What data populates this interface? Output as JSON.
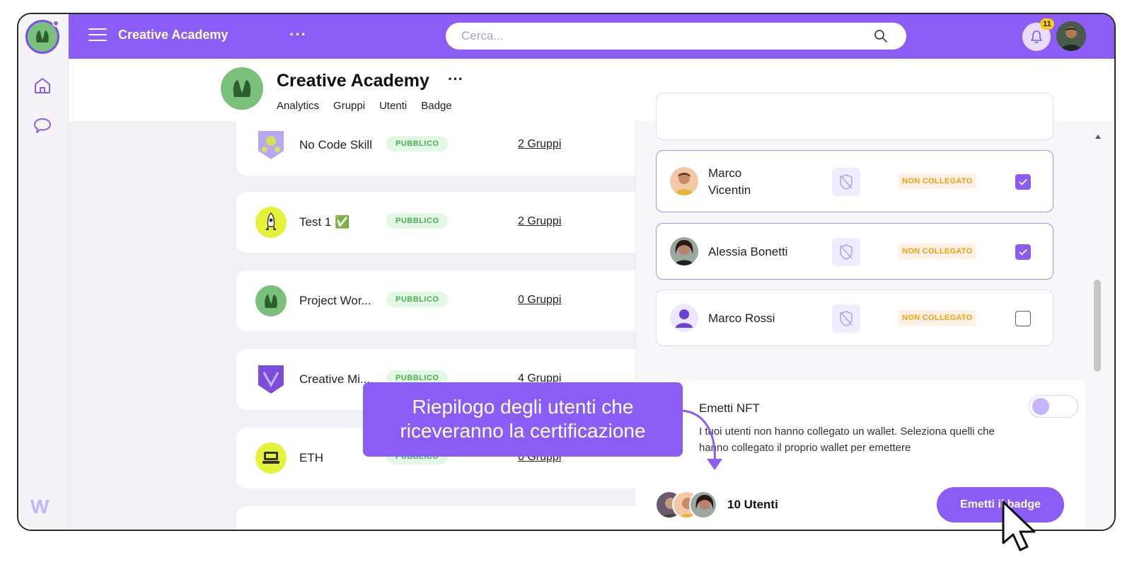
{
  "topbar": {
    "app_title": "Creative Academy",
    "search_placeholder": "Cerca...",
    "notifications_count": "11"
  },
  "header": {
    "org_name": "Creative Academy",
    "tabs": [
      {
        "label": "Analytics",
        "active": false
      },
      {
        "label": "Gruppi",
        "active": false
      },
      {
        "label": "Utenti",
        "active": false
      },
      {
        "label": "Badge",
        "active": true
      }
    ]
  },
  "badges": [
    {
      "name": "No Code Skill",
      "visibility": "PUBBLICO",
      "groups": "2 Gruppi"
    },
    {
      "name": "Test 1 ✅",
      "visibility": "PUBBLICO",
      "groups": "2 Gruppi"
    },
    {
      "name": "Project Wor...",
      "visibility": "PUBBLICO",
      "groups": "0 Gruppi"
    },
    {
      "name": "Creative Mi...",
      "visibility": "PUBBLICO",
      "groups": "4 Gruppi"
    },
    {
      "name": "ETH",
      "visibility": "PUBBLICO",
      "groups": "0 Gruppi"
    }
  ],
  "drawer": {
    "users": [
      {
        "name_line1": "Marco",
        "name_line2": "Vicentin",
        "status": "NON COLLEGATO",
        "checked": true
      },
      {
        "name_line1": "Alessia Bonetti",
        "name_line2": "",
        "status": "NON COLLEGATO",
        "checked": true
      },
      {
        "name_line1": "Marco Rossi",
        "name_line2": "",
        "status": "NON COLLEGATO",
        "checked": false
      }
    ],
    "nft_title": "Emetti NFT",
    "nft_description": "I tuoi utenti non hanno collegato un wallet. Seleziona quelli che hanno collegato il proprio wallet per emettere",
    "users_count": "10 Utenti",
    "emit_button": "Emetti il badge"
  },
  "callout": {
    "line1": "Riepilogo degli utenti che",
    "line2": "riceveranno la certificazione"
  },
  "colors": {
    "accent": "#8b5cf6",
    "status_orange": "#f59e0b",
    "public_green": "#4caf50"
  }
}
